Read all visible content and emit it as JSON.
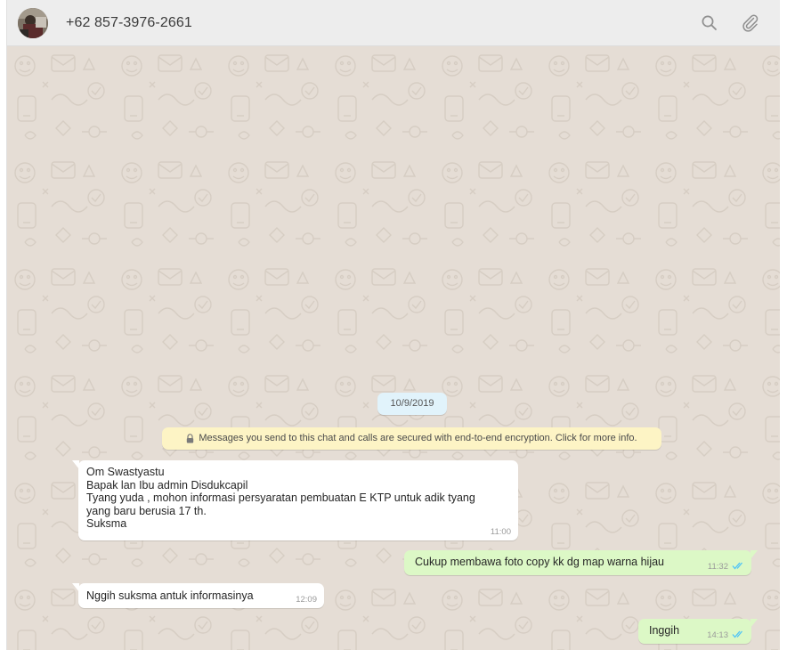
{
  "header": {
    "contact_name": "+62 857-3976-2661",
    "search_icon": "search-icon",
    "attach_icon": "paperclip-icon"
  },
  "chat": {
    "date_chip": "10/9/2019",
    "encryption_notice": "Messages you send to this chat and calls are secured with end-to-end encryption. Click for more info.",
    "messages": [
      {
        "direction": "incoming",
        "text": "Om Swastyastu\nBapak lan Ibu admin Disdukcapil\nTyang yuda , mohon informasi persyaratan pembuatan E KTP untuk adik tyang\nyang baru berusia 17 th.\nSuksma",
        "time": "11:00"
      },
      {
        "direction": "outgoing",
        "text": "Cukup membawa foto copy kk dg map warna hijau",
        "time": "11:32",
        "status": "read"
      },
      {
        "direction": "incoming",
        "text": "Nggih suksma antuk informasinya",
        "time": "12:09"
      },
      {
        "direction": "outgoing",
        "text": "Inggih",
        "time": "14:13",
        "status": "read"
      }
    ]
  },
  "colors": {
    "header_bg": "#ededed",
    "chat_bg": "#e5ddd5",
    "incoming_bubble": "#ffffff",
    "outgoing_bubble": "#dcf8c6",
    "date_chip": "#e1f3fb",
    "encryption_bg": "#fdf4c5",
    "read_ticks": "#4fc3f7"
  }
}
